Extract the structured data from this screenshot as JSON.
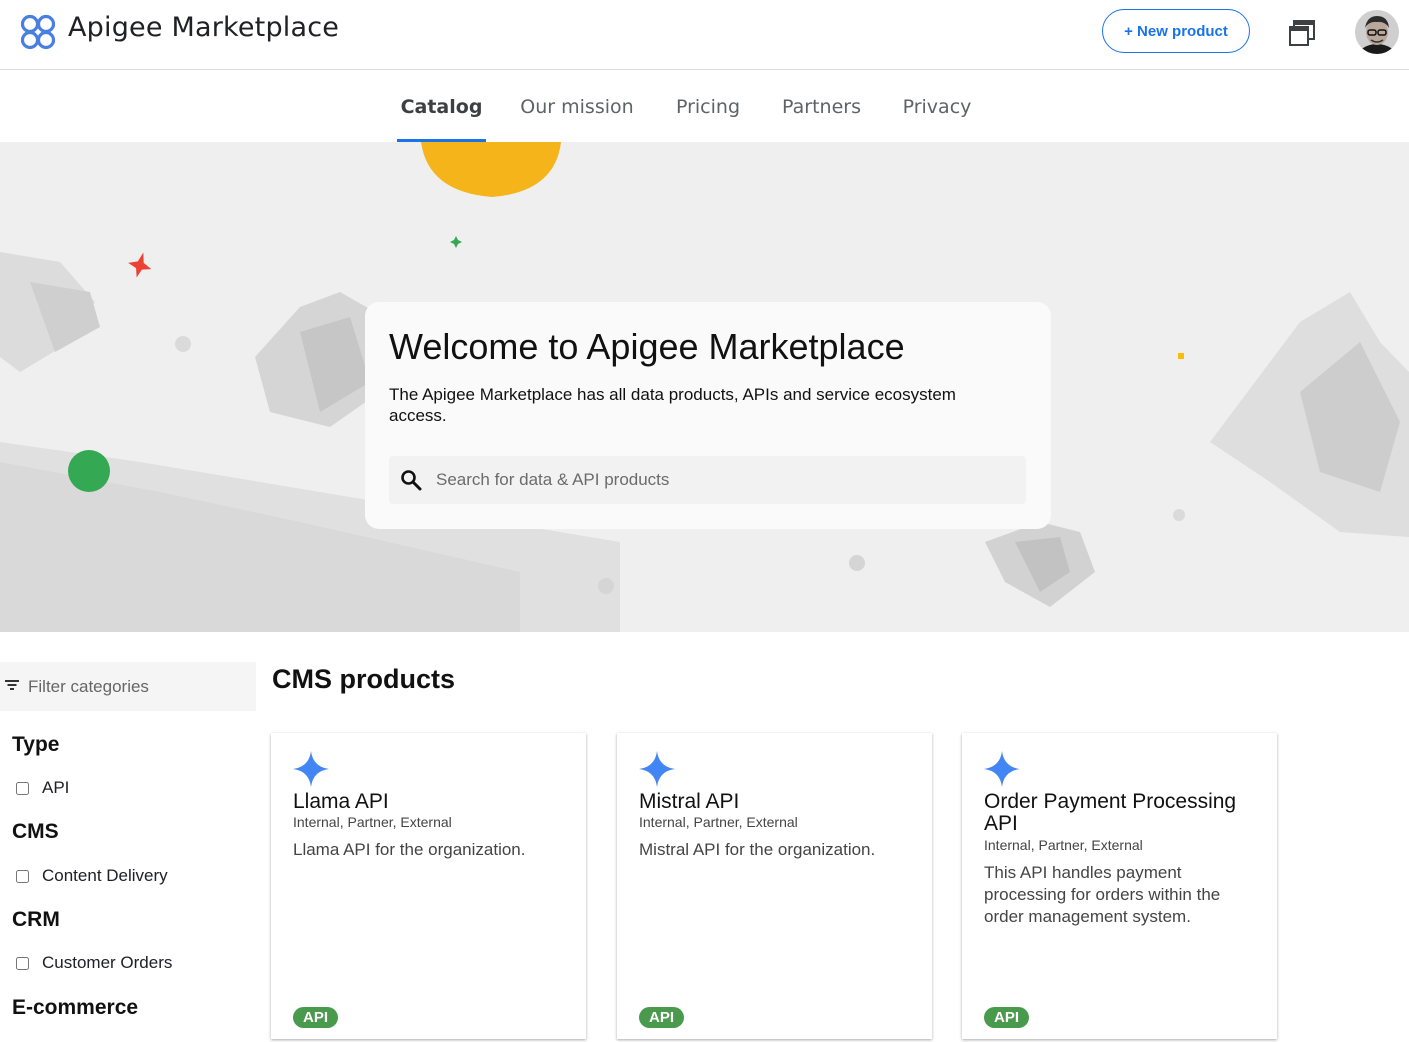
{
  "app": {
    "title": "Apigee Marketplace"
  },
  "header": {
    "new_product_label": "+ New product",
    "logo_icon": "apigee-logo-icon",
    "window_icon": "window-stack-icon"
  },
  "tabs": [
    {
      "label": "Catalog",
      "active": true
    },
    {
      "label": "Our mission",
      "active": false
    },
    {
      "label": "Pricing",
      "active": false
    },
    {
      "label": "Partners",
      "active": false
    },
    {
      "label": "Privacy",
      "active": false
    }
  ],
  "hero": {
    "title": "Welcome to Apigee Marketplace",
    "description": "The Apigee Marketplace has all data products, APIs and service ecosystem access.",
    "search_placeholder": "Search for data & API products"
  },
  "sidebar": {
    "filter_placeholder": "Filter categories",
    "categories": [
      {
        "heading": "Type",
        "options": [
          {
            "label": "API",
            "checked": false
          }
        ]
      },
      {
        "heading": "CMS",
        "options": [
          {
            "label": "Content Delivery",
            "checked": false
          }
        ]
      },
      {
        "heading": "CRM",
        "options": [
          {
            "label": "Customer Orders",
            "checked": false
          }
        ]
      },
      {
        "heading": "E-commerce",
        "options": []
      }
    ]
  },
  "products": {
    "section_title": "CMS products",
    "items": [
      {
        "name": "Llama API",
        "audience": "Internal, Partner, External",
        "description": "Llama API for the organization.",
        "badge": "API"
      },
      {
        "name": "Mistral API",
        "audience": "Internal, Partner, External",
        "description": "Mistral API for the organization.",
        "badge": "API"
      },
      {
        "name": "Order Payment Processing API",
        "audience": "Internal, Partner, External",
        "description": "This API handles payment processing for orders within the order management system.",
        "badge": "API"
      }
    ]
  },
  "colors": {
    "accent": "#1a73e8",
    "badge": "#4a9a4e",
    "star": "#4285f4"
  }
}
